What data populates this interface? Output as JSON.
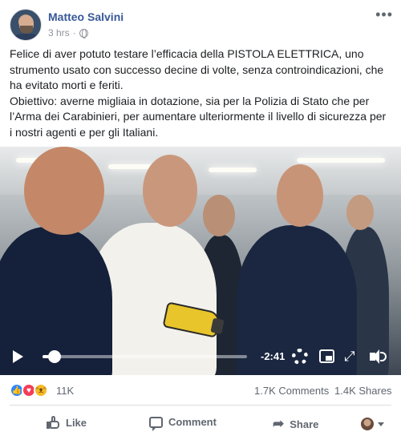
{
  "post": {
    "author": "Matteo Salvini",
    "time": "3 hrs",
    "privacy_icon": "globe-icon",
    "text_lines": [
      "Felice di aver potuto testare l’efficacia della PISTOLA ELETTRICA, uno",
      "strumento usato con successo decine di volte, senza controindicazioni, che",
      "ha evitato morti e feriti.",
      "Obiettivo: averne migliaia in dotazione, sia per la Polizia di Stato che per",
      "l’Arma dei Carabinieri, per aumentare ulteriormente il livello di sicurezza per",
      "i nostri agenti e per gli Italiani."
    ]
  },
  "video": {
    "time_remaining": "-2:41",
    "progress": 0.03,
    "icons": [
      "play-icon",
      "gear-icon",
      "picture-in-picture-icon",
      "expand-icon",
      "volume-icon"
    ]
  },
  "reactions": {
    "count": "11K",
    "icons": [
      "like",
      "love",
      "haha"
    ],
    "comments": "1.7K Comments",
    "shares": "1.4K Shares"
  },
  "actions": {
    "like": "Like",
    "comment": "Comment",
    "share": "Share"
  },
  "colors": {
    "author": "#385898",
    "muted": "#90949c",
    "like_blue": "#2d88ff",
    "love_red": "#f33e58",
    "haha_yellow": "#f7b928"
  }
}
